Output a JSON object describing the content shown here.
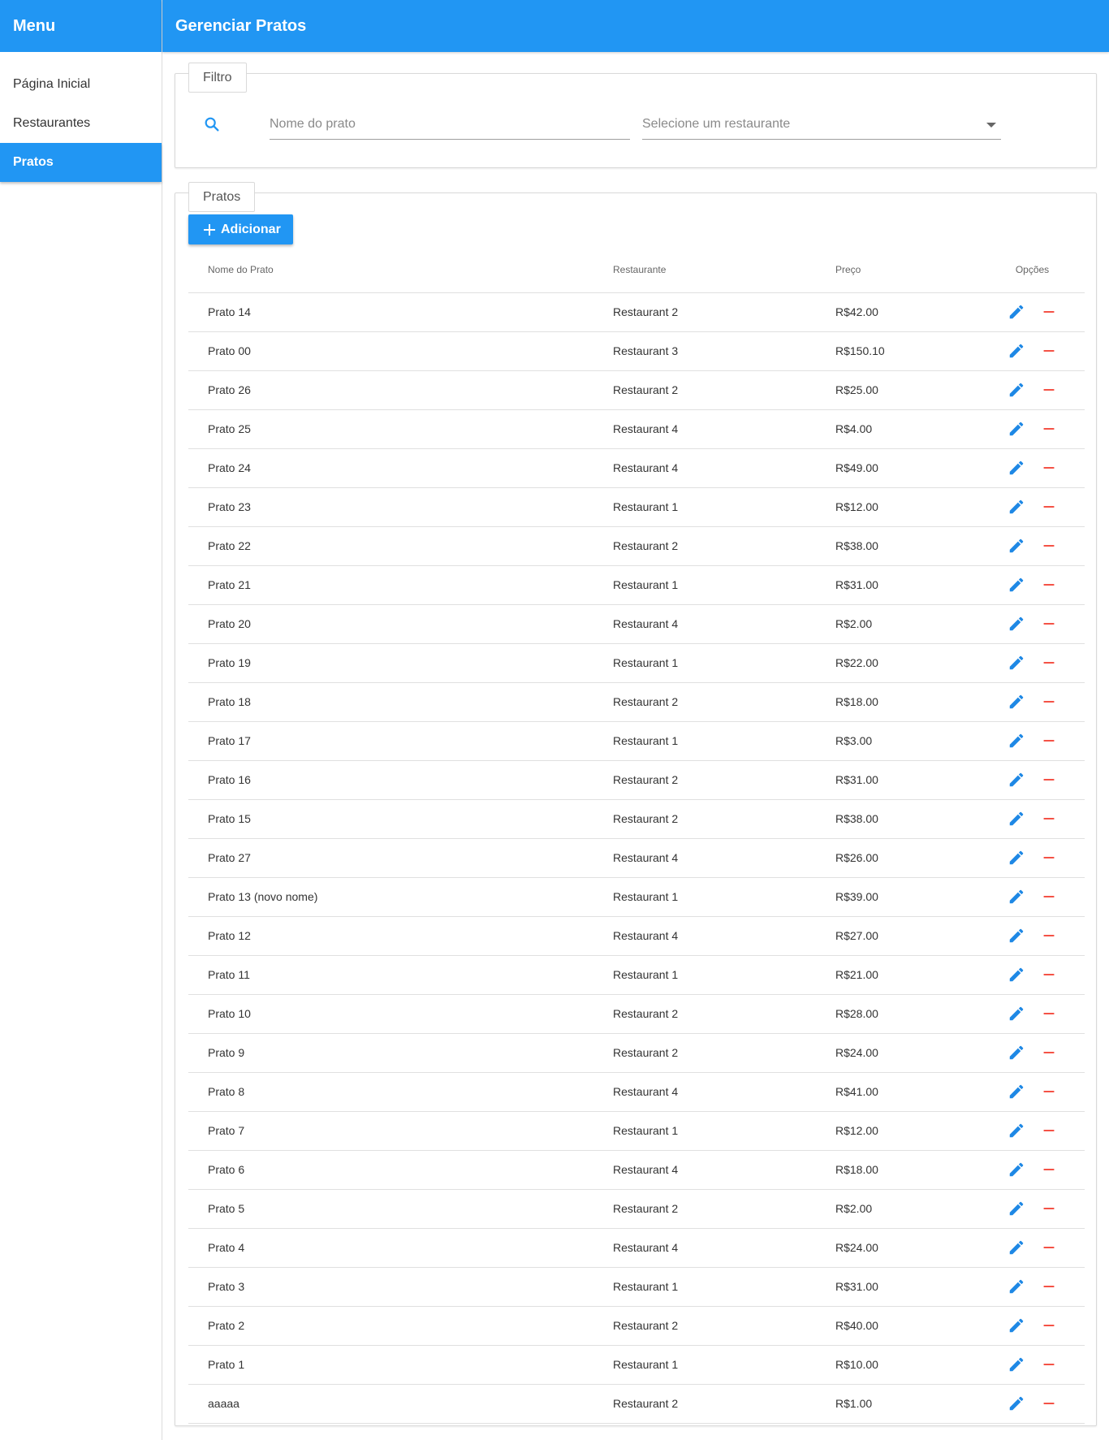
{
  "sidebar": {
    "title": "Menu",
    "items": [
      {
        "label": "Página Inicial",
        "active": false
      },
      {
        "label": "Restaurantes",
        "active": false
      },
      {
        "label": "Pratos",
        "active": true
      }
    ]
  },
  "header": {
    "title": "Gerenciar Pratos"
  },
  "filter": {
    "legend": "Filtro",
    "name_placeholder": "Nome do prato",
    "name_value": "",
    "restaurant_placeholder": "Selecione um restaurante"
  },
  "list": {
    "legend": "Pratos",
    "add_label": "Adicionar",
    "columns": [
      "Nome do Prato",
      "Restaurante",
      "Preço",
      "Opções"
    ],
    "rows": [
      [
        "Prato 14",
        "Restaurant 2",
        "R$42.00"
      ],
      [
        "Prato 00",
        "Restaurant 3",
        "R$150.10"
      ],
      [
        "Prato 26",
        "Restaurant 2",
        "R$25.00"
      ],
      [
        "Prato 25",
        "Restaurant 4",
        "R$4.00"
      ],
      [
        "Prato 24",
        "Restaurant 4",
        "R$49.00"
      ],
      [
        "Prato 23",
        "Restaurant 1",
        "R$12.00"
      ],
      [
        "Prato 22",
        "Restaurant 2",
        "R$38.00"
      ],
      [
        "Prato 21",
        "Restaurant 1",
        "R$31.00"
      ],
      [
        "Prato 20",
        "Restaurant 4",
        "R$2.00"
      ],
      [
        "Prato 19",
        "Restaurant 1",
        "R$22.00"
      ],
      [
        "Prato 18",
        "Restaurant 2",
        "R$18.00"
      ],
      [
        "Prato 17",
        "Restaurant 1",
        "R$3.00"
      ],
      [
        "Prato 16",
        "Restaurant 2",
        "R$31.00"
      ],
      [
        "Prato 15",
        "Restaurant 2",
        "R$38.00"
      ],
      [
        "Prato 27",
        "Restaurant 4",
        "R$26.00"
      ],
      [
        "Prato 13 (novo nome)",
        "Restaurant 1",
        "R$39.00"
      ],
      [
        "Prato 12",
        "Restaurant 4",
        "R$27.00"
      ],
      [
        "Prato 11",
        "Restaurant 1",
        "R$21.00"
      ],
      [
        "Prato 10",
        "Restaurant 2",
        "R$28.00"
      ],
      [
        "Prato 9",
        "Restaurant 2",
        "R$24.00"
      ],
      [
        "Prato 8",
        "Restaurant 4",
        "R$41.00"
      ],
      [
        "Prato 7",
        "Restaurant 1",
        "R$12.00"
      ],
      [
        "Prato 6",
        "Restaurant 4",
        "R$18.00"
      ],
      [
        "Prato 5",
        "Restaurant 2",
        "R$2.00"
      ],
      [
        "Prato 4",
        "Restaurant 4",
        "R$24.00"
      ],
      [
        "Prato 3",
        "Restaurant 1",
        "R$31.00"
      ],
      [
        "Prato 2",
        "Restaurant 2",
        "R$40.00"
      ],
      [
        "Prato 1",
        "Restaurant 1",
        "R$10.00"
      ],
      [
        "aaaaa",
        "Restaurant 2",
        "R$1.00"
      ]
    ]
  },
  "colors": {
    "primary": "#2196f3",
    "edit_icon": "#1e88e5",
    "remove_icon": "#f44336"
  },
  "icons": {
    "search": "search-icon",
    "add": "plus-icon",
    "edit": "pencil-icon",
    "remove": "minus-icon",
    "dropdown": "caret-down-icon"
  }
}
